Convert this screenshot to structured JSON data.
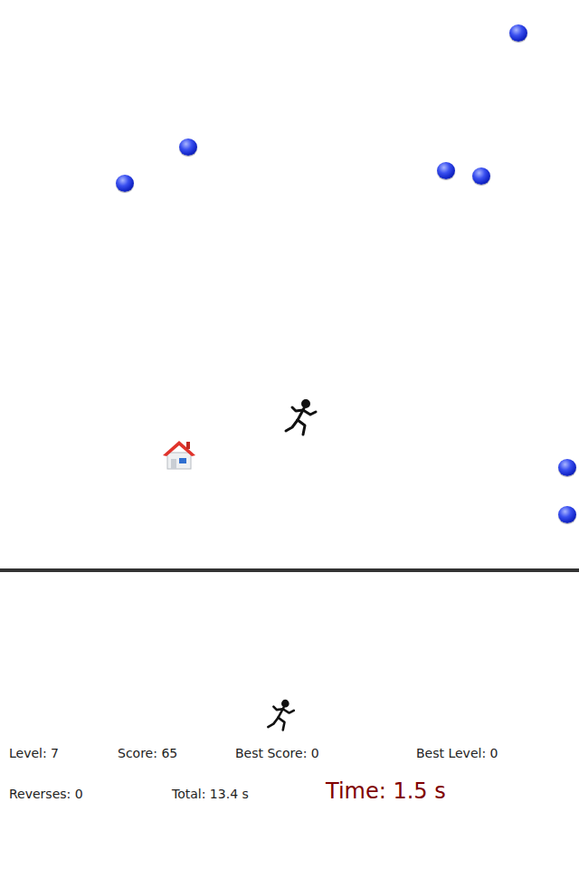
{
  "game": {
    "player": "runner",
    "home": "house"
  },
  "stats_rows": [
    [
      {
        "text": "Level: 7",
        "kind": "stat"
      },
      {
        "text": "Score: 65",
        "kind": "stat"
      },
      {
        "text": "Best Score: 0",
        "kind": "stat"
      },
      {
        "text": "Best Level: 0",
        "kind": "stat"
      }
    ],
    [
      {
        "text": "Reverses: 0",
        "kind": "stat"
      },
      {
        "text": "Total: 13.4 s",
        "kind": "stat"
      },
      {
        "text": "Time: 1.5 s",
        "kind": "timer"
      }
    ]
  ]
}
